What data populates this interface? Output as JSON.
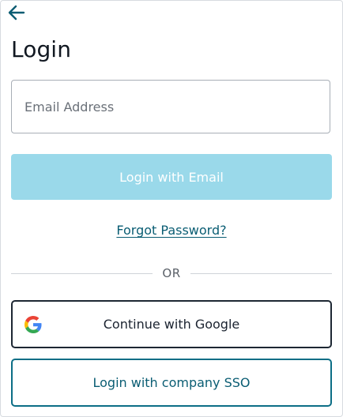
{
  "header": {
    "back_icon": "arrow-left-icon",
    "title": "Login"
  },
  "form": {
    "email_placeholder": "Email Address",
    "email_value": "",
    "login_email_label": "Login with Email",
    "forgot_password_label": "Forgot Password?"
  },
  "divider": {
    "label": "OR"
  },
  "social": {
    "google_icon": "google-logo-icon",
    "google_label": "Continue with Google",
    "sso_label": "Login with company SSO"
  },
  "colors": {
    "accent": "#0a5d73",
    "disabled_button": "#9ad9ea",
    "dark_border": "#1d2733"
  }
}
